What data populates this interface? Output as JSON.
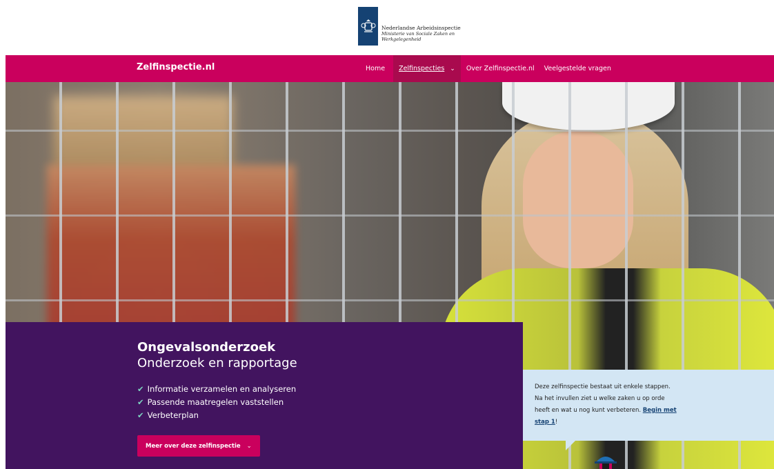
{
  "header": {
    "logo_title": "Nederlandse Arbeidsinspectie",
    "logo_sub_line1": "Ministerie van Sociale Zaken en",
    "logo_sub_line2": "Werkgelegenheid"
  },
  "nav": {
    "brand": "Zelfinspectie.nl",
    "items": [
      {
        "label": "Home"
      },
      {
        "label": "Zelfinspecties"
      },
      {
        "label": "Over Zelfinspectie.nl"
      },
      {
        "label": "Veelgestelde vragen"
      }
    ]
  },
  "hero_panel": {
    "title": "Ongevalsonderzoek",
    "subtitle": "Onderzoek en rapportage",
    "bullets": [
      "Informatie verzamelen en analyseren",
      "Passende maatregelen vaststellen",
      "Verbeterplan"
    ],
    "button_label": "Meer over deze zelfinspectie"
  },
  "info_box": {
    "text_before_link": "Deze zelfinspectie bestaat uit enkele stappen. Na het invullen ziet u welke zaken u op orde heeft en wat u nog kunt verbeteren. ",
    "link_text": "Begin met stap 1",
    "text_after_link": "!"
  },
  "colors": {
    "nav_bg": "#ca005d",
    "panel_bg": "#42145f",
    "info_bg": "#d3e6f4",
    "logo_blue": "#154273"
  },
  "icons": {
    "logo": "coat-of-arms-icon",
    "check": "checkmark-icon",
    "chevron": "chevron-down-icon"
  }
}
